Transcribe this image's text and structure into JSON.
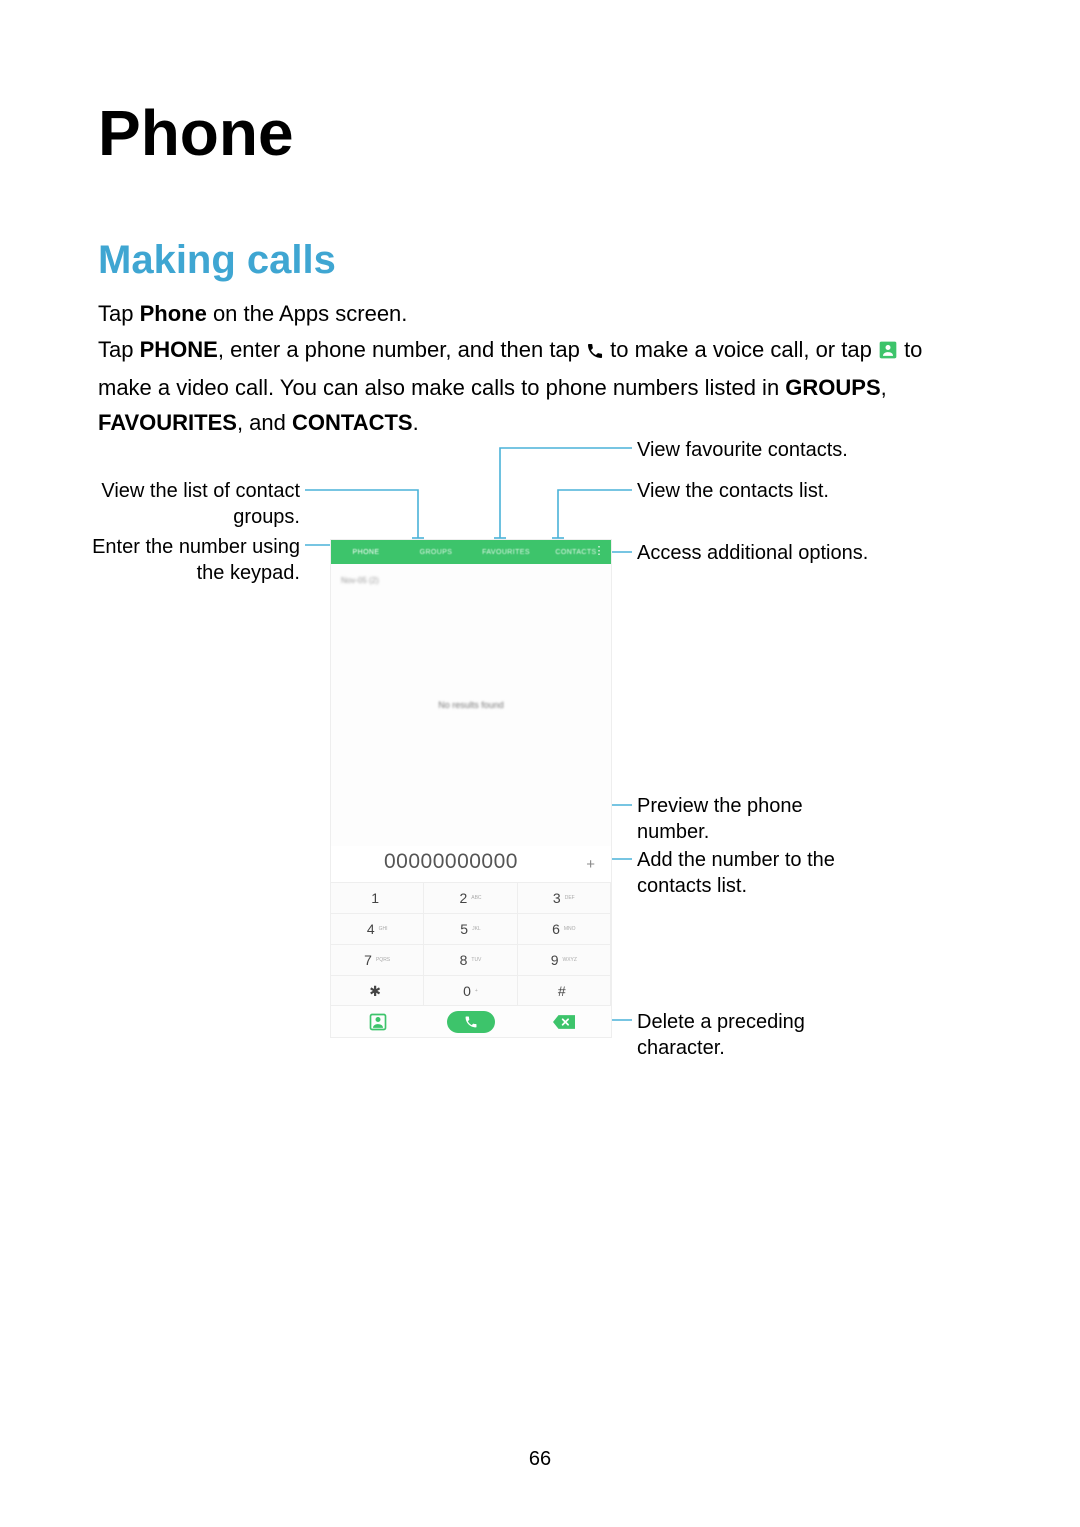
{
  "page": {
    "title": "Phone",
    "section": "Making calls",
    "number": "66"
  },
  "body": {
    "p1_1": "Tap ",
    "p1_bold": "Phone",
    "p1_2": " on the Apps screen.",
    "p2_1": "Tap ",
    "p2_bold1": "PHONE",
    "p2_2": ", enter a phone number, and then tap ",
    "p2_3": " to make a voice call, or tap ",
    "p2_4": " to make a video call. You can also make calls to phone numbers listed in ",
    "p2_bold2": "GROUPS",
    "p2_5": ", ",
    "p2_bold3": "FAVOURITES",
    "p2_6": ", and ",
    "p2_bold4": "CONTACTS",
    "p2_7": "."
  },
  "callouts": {
    "c1": "View favourite contacts.",
    "c2": "View the list of contact groups.",
    "c3": "View the contacts list.",
    "c4": "Enter the number using the keypad.",
    "c5": "Access additional options.",
    "c6": "Preview the phone number.",
    "c7": "Add the number to the contacts list.",
    "c8": "Delete a preceding character."
  },
  "phone": {
    "tabs": [
      "PHONE",
      "GROUPS",
      "FAVOURITES",
      "CONTACTS"
    ],
    "sub": "Nov-05 (2)",
    "noresults": "No results found",
    "number": "00000000000",
    "plus": "+",
    "keys": [
      {
        "d": "1",
        "l": ""
      },
      {
        "d": "2",
        "l": "ABC"
      },
      {
        "d": "3",
        "l": "DEF"
      },
      {
        "d": "4",
        "l": "GHI"
      },
      {
        "d": "5",
        "l": "JKL"
      },
      {
        "d": "6",
        "l": "MNO"
      },
      {
        "d": "7",
        "l": "PQRS"
      },
      {
        "d": "8",
        "l": "TUV"
      },
      {
        "d": "9",
        "l": "WXYZ"
      },
      {
        "d": "✱",
        "l": ""
      },
      {
        "d": "0",
        "l": "+"
      },
      {
        "d": "#",
        "l": ""
      }
    ]
  },
  "colors": {
    "accent_heading": "#3fa6d2",
    "ui_green": "#3dc46b",
    "leader": "#4ab2d8"
  }
}
